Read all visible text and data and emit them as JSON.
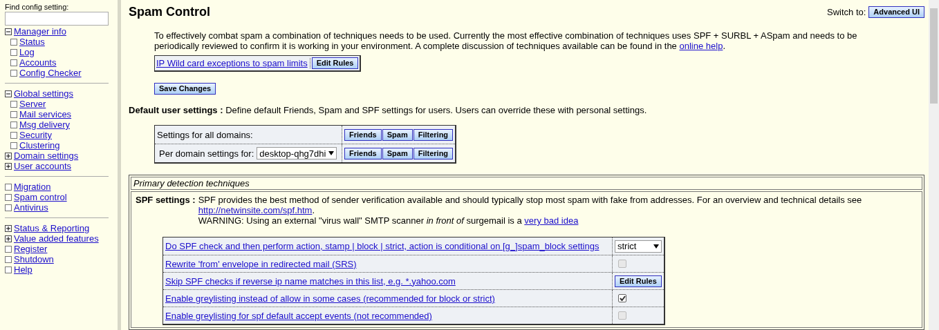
{
  "sidebar": {
    "search": {
      "label": "Find config setting:"
    },
    "sections": [
      [
        {
          "label": "Manager info",
          "kind": "group",
          "expanded": true,
          "children": [
            {
              "label": "Status"
            },
            {
              "label": "Log"
            },
            {
              "label": "Accounts"
            },
            {
              "label": "Config Checker"
            }
          ]
        }
      ],
      [
        {
          "label": "Global settings",
          "kind": "group",
          "expanded": true,
          "children": [
            {
              "label": "Server"
            },
            {
              "label": "Mail services"
            },
            {
              "label": "Msg delivery"
            },
            {
              "label": "Security"
            },
            {
              "label": "Clustering"
            }
          ]
        },
        {
          "label": "Domain settings",
          "kind": "group",
          "expanded": false
        },
        {
          "label": "User accounts",
          "kind": "group",
          "expanded": false
        }
      ],
      [
        {
          "label": "Migration",
          "kind": "leaf"
        },
        {
          "label": "Spam control",
          "kind": "leaf"
        },
        {
          "label": "Antivirus",
          "kind": "leaf"
        }
      ],
      [
        {
          "label": "Status & Reporting",
          "kind": "group",
          "expanded": false
        },
        {
          "label": "Value added features",
          "kind": "group",
          "expanded": false
        },
        {
          "label": "Register",
          "kind": "leaf"
        },
        {
          "label": "Shutdown",
          "kind": "leaf"
        },
        {
          "label": "Help",
          "kind": "leaf"
        }
      ]
    ]
  },
  "page": {
    "title": "Spam Control",
    "switch_label": "Switch to:",
    "switch_button": "Advanced UI",
    "intro": {
      "text": "To effectively combat spam a combination of techniques needs to be used. Currently the most effective combination of techniques uses SPF + SURBL + ASpam and needs to be periodically reviewed to confirm it is working in your environment. A complete discussion of techniques available can be found in the",
      "link": "online help",
      "after": "."
    },
    "ip_exceptions": {
      "link": "IP Wild card exceptions to spam limits",
      "button": "Edit Rules"
    },
    "save_button": "Save Changes",
    "default_user": {
      "heading": "Default user settings :",
      "text": "Define default Friends, Spam and SPF settings for users. Users can override these with personal settings.",
      "rows": [
        {
          "label": "Settings for all domains:",
          "buttons": [
            "Friends",
            "Spam",
            "Filtering"
          ]
        },
        {
          "label": "Per domain settings for:",
          "select": "desktop-qhg7dhi",
          "buttons": [
            "Friends",
            "Spam",
            "Filtering"
          ]
        }
      ]
    },
    "primary": {
      "caption": "Primary detection techniques",
      "spf": {
        "heading": "SPF settings :",
        "text": "SPF provides the best method of sender verification available and should typically stop most spam with fake from addresses. For an overview and technical details see",
        "link": "http://netwinsite.com/spf.htm",
        "link_after": ".",
        "warning": "WARNING: Using an external \"virus wall\" SMTP scanner *in front of* surgemail is a",
        "warning_link": "very bad idea",
        "rows": [
          {
            "label": "Do SPF check and then perform action, stamp | block | strict, action is conditional on [g_]spam_block settings",
            "kind": "select",
            "value": "strict"
          },
          {
            "label": "Rewrite 'from' envelope in redirected mail (SRS)",
            "kind": "checkbox",
            "checked": false
          },
          {
            "label": "Skip SPF checks if reverse ip name matches in this list, e.g. *.yahoo.com",
            "kind": "button",
            "button": "Edit Rules"
          },
          {
            "label": "Enable greylisting instead of allow in some cases (recommended for block or strict)",
            "kind": "checkbox",
            "checked": true
          },
          {
            "label": "Enable greylisting for spf default accept events (not recommended)",
            "kind": "checkbox",
            "checked": false
          }
        ]
      }
    }
  }
}
